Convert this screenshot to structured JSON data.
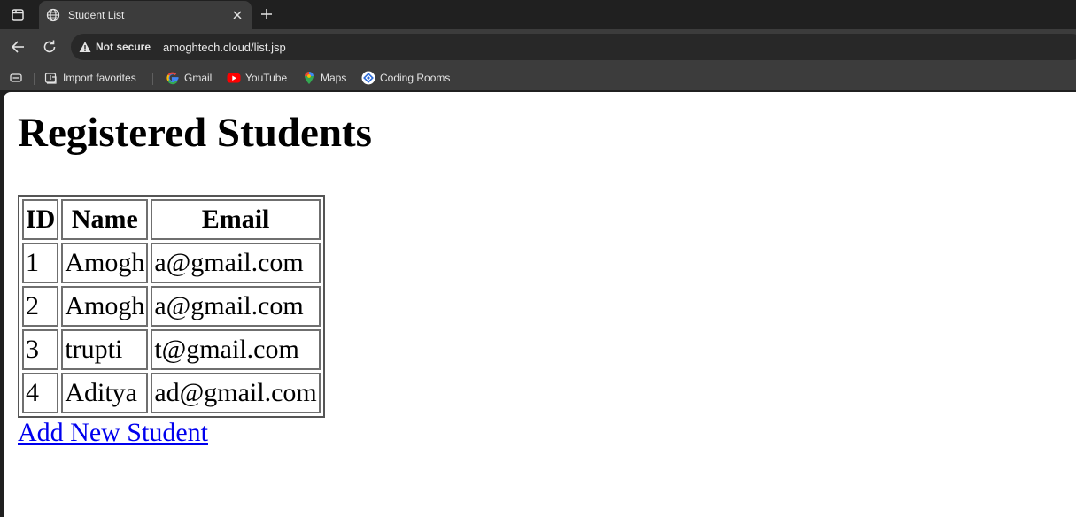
{
  "browser": {
    "tab_title": "Student List",
    "not_secure_label": "Not secure",
    "url": "amoghtech.cloud/list.jsp",
    "bookmarks": [
      {
        "label": "Import favorites",
        "icon": "import-icon"
      },
      {
        "label": "Gmail",
        "icon": "google-icon"
      },
      {
        "label": "YouTube",
        "icon": "youtube-icon"
      },
      {
        "label": "Maps",
        "icon": "maps-pin-icon"
      },
      {
        "label": "Coding Rooms",
        "icon": "coding-rooms-icon"
      }
    ]
  },
  "page": {
    "heading": "Registered Students",
    "table": {
      "headers": [
        "ID",
        "Name",
        "Email"
      ],
      "rows": [
        [
          "1",
          "Amogh",
          "a@gmail.com"
        ],
        [
          "2",
          "Amogh",
          "a@gmail.com"
        ],
        [
          "3",
          "trupti",
          "t@gmail.com"
        ],
        [
          "4",
          "Aditya",
          "ad@gmail.com"
        ]
      ]
    },
    "add_link": "Add New Student"
  },
  "colors": {
    "link": "#0000ee",
    "chrome_dark": "#202020",
    "chrome_toolbar": "#3c3c3c"
  }
}
